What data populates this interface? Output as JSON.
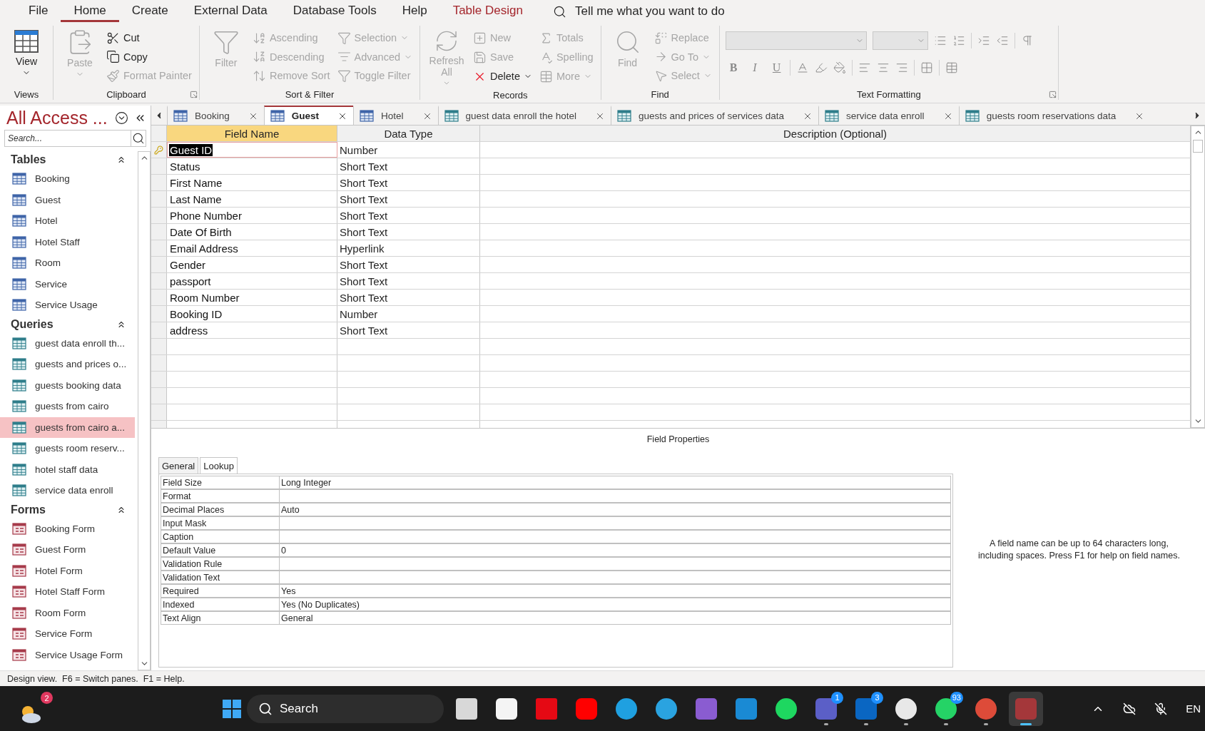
{
  "menu": {
    "tabs": [
      {
        "label": "File",
        "selected": false,
        "kind": "normal"
      },
      {
        "label": "Home",
        "selected": true,
        "kind": "normal"
      },
      {
        "label": "Create",
        "selected": false,
        "kind": "normal"
      },
      {
        "label": "External Data",
        "selected": false,
        "kind": "normal"
      },
      {
        "label": "Database Tools",
        "selected": false,
        "kind": "normal"
      },
      {
        "label": "Help",
        "selected": false,
        "kind": "normal"
      },
      {
        "label": "Table Design",
        "selected": false,
        "kind": "contextual"
      }
    ],
    "tell_me": {
      "placeholder": "Tell me what you want to do"
    }
  },
  "ribbon": {
    "groups": [
      {
        "label": "Views",
        "launcher": false,
        "large": [
          {
            "label": "View",
            "disabled": false,
            "dropdown": true
          }
        ]
      },
      {
        "label": "Clipboard",
        "launcher": true,
        "large": [
          {
            "label": "Paste",
            "disabled": true,
            "dropdown": true
          }
        ],
        "columns": [
          [
            {
              "label": "Cut",
              "disabled": false,
              "dropdown": false
            },
            {
              "label": "Copy",
              "disabled": false,
              "dropdown": false
            },
            {
              "label": "Format Painter",
              "disabled": true,
              "dropdown": false
            }
          ]
        ]
      },
      {
        "label": "Sort & Filter",
        "launcher": false,
        "large": [
          {
            "label": "Filter",
            "disabled": true,
            "dropdown": false
          }
        ],
        "columns": [
          [
            {
              "label": "Ascending",
              "disabled": true,
              "dropdown": false
            },
            {
              "label": "Descending",
              "disabled": true,
              "dropdown": false
            },
            {
              "label": "Remove Sort",
              "disabled": true,
              "dropdown": false
            }
          ],
          [
            {
              "label": "Selection",
              "disabled": true,
              "dropdown": true
            },
            {
              "label": "Advanced",
              "disabled": true,
              "dropdown": true
            },
            {
              "label": "Toggle Filter",
              "disabled": true,
              "dropdown": false
            }
          ]
        ]
      },
      {
        "label": "Records",
        "launcher": false,
        "large": [
          {
            "label": "Refresh All",
            "disabled": true,
            "dropdown": true
          }
        ],
        "columns": [
          [
            {
              "label": "New",
              "disabled": true,
              "dropdown": false
            },
            {
              "label": "Save",
              "disabled": true,
              "dropdown": false
            },
            {
              "label": "Delete",
              "disabled": false,
              "dropdown": true
            }
          ],
          [
            {
              "label": "Totals",
              "disabled": true,
              "dropdown": false
            },
            {
              "label": "Spelling",
              "disabled": true,
              "dropdown": false
            },
            {
              "label": "More",
              "disabled": true,
              "dropdown": true
            }
          ]
        ]
      },
      {
        "label": "Find",
        "launcher": false,
        "large": [
          {
            "label": "Find",
            "disabled": true,
            "dropdown": false
          }
        ],
        "columns": [
          [
            {
              "label": "Replace",
              "disabled": true,
              "dropdown": false
            },
            {
              "label": "Go To",
              "disabled": true,
              "dropdown": true
            },
            {
              "label": "Select",
              "disabled": true,
              "dropdown": true
            }
          ]
        ]
      }
    ],
    "text_formatting": {
      "label": "Text Formatting",
      "launcher": true,
      "style_buttons": [
        "B",
        "I",
        "U"
      ]
    }
  },
  "nav_pane": {
    "title": "All Access ...",
    "search": {
      "placeholder": "Search..."
    },
    "sections": [
      {
        "title": "Tables",
        "kind": "table",
        "items": [
          {
            "label": "Booking",
            "selected": false
          },
          {
            "label": "Guest",
            "selected": false
          },
          {
            "label": "Hotel",
            "selected": false
          },
          {
            "label": "Hotel Staff",
            "selected": false
          },
          {
            "label": "Room",
            "selected": false
          },
          {
            "label": "Service",
            "selected": false
          },
          {
            "label": "Service Usage",
            "selected": false
          }
        ]
      },
      {
        "title": "Queries",
        "kind": "query",
        "items": [
          {
            "label": "guest data enroll th...",
            "selected": false
          },
          {
            "label": "guests and prices o...",
            "selected": false
          },
          {
            "label": "guests booking data",
            "selected": false
          },
          {
            "label": "guests from cairo",
            "selected": false
          },
          {
            "label": "guests from cairo a...",
            "selected": true
          },
          {
            "label": "guests room reserv...",
            "selected": false
          },
          {
            "label": "hotel staff data",
            "selected": false
          },
          {
            "label": "service data enroll",
            "selected": false
          }
        ]
      },
      {
        "title": "Forms",
        "kind": "form",
        "items": [
          {
            "label": "Booking Form",
            "selected": false
          },
          {
            "label": "Guest Form",
            "selected": false
          },
          {
            "label": "Hotel Form",
            "selected": false
          },
          {
            "label": "Hotel Staff Form",
            "selected": false
          },
          {
            "label": "Room Form",
            "selected": false
          },
          {
            "label": "Service Form",
            "selected": false
          },
          {
            "label": "Service Usage Form",
            "selected": false
          }
        ]
      }
    ]
  },
  "document_tabs": [
    {
      "label": "Booking",
      "kind": "table",
      "selected": false
    },
    {
      "label": "Guest",
      "kind": "table",
      "selected": true
    },
    {
      "label": "Hotel",
      "kind": "table",
      "selected": false
    },
    {
      "label": "guest data enroll the hotel",
      "kind": "query",
      "selected": false
    },
    {
      "label": "guests and prices of services data",
      "kind": "query",
      "selected": false
    },
    {
      "label": "service data enroll",
      "kind": "query",
      "selected": false
    },
    {
      "label": "guests room reservations data",
      "kind": "query",
      "selected": false
    }
  ],
  "design_grid": {
    "columns": [
      {
        "label": "Field Name",
        "selected": true
      },
      {
        "label": "Data Type",
        "selected": false
      },
      {
        "label": "Description (Optional)",
        "selected": false
      }
    ],
    "rows": [
      {
        "field_name": "Guest ID",
        "data_type": "Number",
        "primary_key": true,
        "selected": true
      },
      {
        "field_name": "Status",
        "data_type": "Short Text",
        "primary_key": false,
        "selected": false
      },
      {
        "field_name": "First Name",
        "data_type": "Short Text",
        "primary_key": false,
        "selected": false
      },
      {
        "field_name": "Last Name",
        "data_type": "Short Text",
        "primary_key": false,
        "selected": false
      },
      {
        "field_name": "Phone Number",
        "data_type": "Short Text",
        "primary_key": false,
        "selected": false
      },
      {
        "field_name": "Date Of Birth",
        "data_type": "Short Text",
        "primary_key": false,
        "selected": false
      },
      {
        "field_name": "Email Address",
        "data_type": "Hyperlink",
        "primary_key": false,
        "selected": false
      },
      {
        "field_name": "Gender",
        "data_type": "Short Text",
        "primary_key": false,
        "selected": false
      },
      {
        "field_name": "passport",
        "data_type": "Short Text",
        "primary_key": false,
        "selected": false
      },
      {
        "field_name": "Room Number",
        "data_type": "Short Text",
        "primary_key": false,
        "selected": false
      },
      {
        "field_name": "Booking ID",
        "data_type": "Number",
        "primary_key": false,
        "selected": false
      },
      {
        "field_name": "address",
        "data_type": "Short Text",
        "primary_key": false,
        "selected": false
      }
    ]
  },
  "field_properties": {
    "title": "Field Properties",
    "tabs": [
      {
        "label": "General",
        "selected": true
      },
      {
        "label": "Lookup",
        "selected": false
      }
    ],
    "rows": [
      {
        "label": "Field Size",
        "value": "Long Integer"
      },
      {
        "label": "Format"
      },
      {
        "label": "Decimal Places",
        "value": "Auto"
      },
      {
        "label": "Input Mask"
      },
      {
        "label": "Caption"
      },
      {
        "label": "Default Value",
        "value": "0"
      },
      {
        "label": "Validation Rule"
      },
      {
        "label": "Validation Text"
      },
      {
        "label": "Required",
        "value": "Yes"
      },
      {
        "label": "Indexed",
        "value": "Yes (No Duplicates)"
      },
      {
        "label": "Text Align",
        "value": "General"
      }
    ],
    "help": "A field name can be up to 64 characters long, including spaces. Press F1 for help on field names."
  },
  "status_bar": "Design view.  F6 = Switch panes.  F1 = Help.",
  "taskbar": {
    "weather_badge": "2",
    "search": {
      "placeholder": "Search"
    },
    "apps": [
      {
        "kind": "task-view",
        "running": false,
        "active": false
      },
      {
        "kind": "store",
        "running": false,
        "active": false
      },
      {
        "kind": "netflix",
        "running": false,
        "active": false
      },
      {
        "kind": "youtube",
        "running": false,
        "active": false
      },
      {
        "kind": "edge",
        "running": false,
        "active": false
      },
      {
        "kind": "telegram",
        "running": false,
        "active": false
      },
      {
        "kind": "visual-studio",
        "running": false,
        "active": false
      },
      {
        "kind": "vscode",
        "running": false,
        "active": false
      },
      {
        "kind": "spotify",
        "running": false,
        "active": false
      },
      {
        "kind": "teams",
        "badge": "1",
        "running": true,
        "active": false
      },
      {
        "kind": "linkedin",
        "badge": "3",
        "running": true,
        "active": false
      },
      {
        "kind": "chatgpt",
        "running": true,
        "active": false
      },
      {
        "kind": "whatsapp",
        "badge": "93",
        "running": true,
        "active": false
      },
      {
        "kind": "chrome",
        "running": true,
        "active": false
      },
      {
        "kind": "access",
        "running": true,
        "active": true
      }
    ],
    "language": "EN"
  }
}
